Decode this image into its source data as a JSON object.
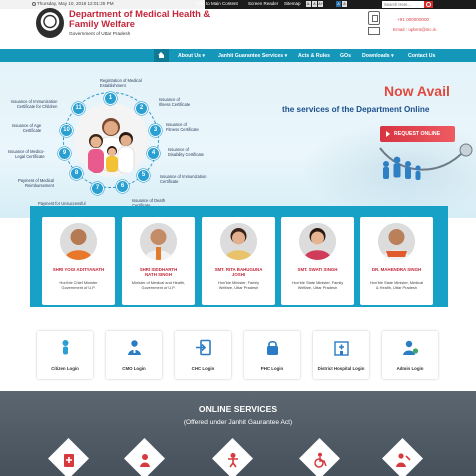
{
  "topbar": {
    "date": "Thursday, May 10, 2018 12:01:25 PM",
    "skip_link": "Skip to Main Content",
    "screen_reader": "Screen Reader",
    "sitemap": "Sitemap",
    "font_sizes": [
      "A-",
      "A",
      "A+",
      "A",
      "A"
    ],
    "search_placeholder": "Search Here..."
  },
  "header": {
    "title": "Department of Medical Health & Family Welfare",
    "subtitle": "Government of Uttar Pradesh",
    "helpline": "+91 000000000",
    "email": "Email : upbmt@nic.in"
  },
  "nav": {
    "items": [
      "About Us ▾",
      "Janhit Guarantee Services ▾",
      "Acts & Rules",
      "GOs",
      "Downloads ▾",
      "Contact Us"
    ]
  },
  "hero": {
    "headline": "Now Avail",
    "subheadline": "the services of the Department Online",
    "request_button": "REQUEST ONLINE"
  },
  "wheel": {
    "items": [
      {
        "num": "1",
        "label": "Registration of Medical\nEstablishment"
      },
      {
        "num": "2",
        "label": "Issuance of\nIllness Certificate"
      },
      {
        "num": "3",
        "label": "Issuance of\nFitness Certificate"
      },
      {
        "num": "4",
        "label": "Issuance of\nDisability Certificate"
      },
      {
        "num": "5",
        "label": "Issuance of Immunization\nCertificate"
      },
      {
        "num": "6",
        "label": "Issuance of Death\nCertificate"
      },
      {
        "num": "7",
        "label": "Payment for Unsuccessful\nFamily Planning"
      },
      {
        "num": "8",
        "label": "Payment of Medical\nReimbursement"
      },
      {
        "num": "9",
        "label": "Issuance of Medico-\nLegal Certificate"
      },
      {
        "num": "10",
        "label": "Issuance of Age\nCertificate"
      },
      {
        "num": "11",
        "label": "Issuance of Immunization\nCertificate for Children"
      }
    ]
  },
  "officials": [
    {
      "name": "SHRI YOGI ADITYANATH",
      "role": "Hon'ble Chief Minister\nGovernment of U.P."
    },
    {
      "name": "SHRI SIDDHARTH\nNATH SINGH",
      "role": "Minister of Medical and Health,\nGovernment of U.P."
    },
    {
      "name": "SMT. RITA BAHUGUNA\nJOSHI",
      "role": "Hon'ble Minister, Family\nWelfare, Uttar Pradesh"
    },
    {
      "name": "SMT. SWATI SINGH",
      "role": "Hon'ble State Minister, Family\nWelfare, Uttar Pradesh"
    },
    {
      "name": "DR. MAHENDRA SINGH",
      "role": "Hon'ble State Minister, Medical\n& Health, Uttar Pradesh"
    }
  ],
  "logins": [
    "Citizen Login",
    "CMO Login",
    "CHC Login",
    "PHC Login",
    "District Hospital Login",
    "Admin Login"
  ],
  "online_services": {
    "title": "ONLINE SERVICES",
    "subtitle": "(Offered under Janhit Gaurantee Act)"
  },
  "colors": {
    "brand_red": "#c4263a",
    "nav_blue": "#1497b9",
    "officials_blue": "#17a1c7",
    "accent_red": "#e04a3e",
    "dark_blue_text": "#1b4f8c"
  }
}
